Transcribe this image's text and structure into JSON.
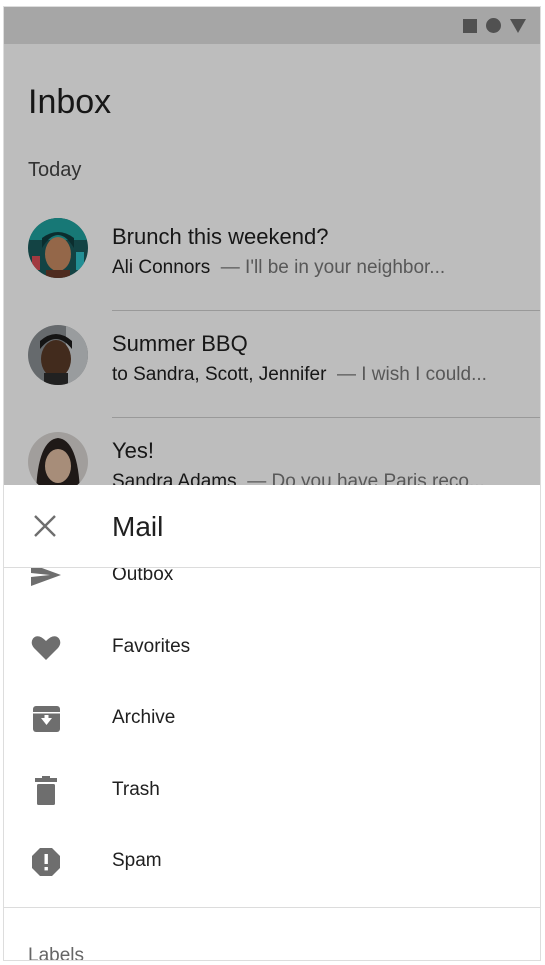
{
  "inbox": {
    "title": "Inbox",
    "section": "Today",
    "messages": [
      {
        "subject": "Brunch this weekend?",
        "from": "Ali Connors",
        "snippet": "— I'll be in your neighbor..."
      },
      {
        "subject": "Summer BBQ",
        "from": "to Sandra, Scott, Jennifer",
        "snippet": "— I wish I could..."
      },
      {
        "subject": "Yes!",
        "from": "Sandra Adams",
        "snippet": "— Do you have Paris reco..."
      }
    ]
  },
  "sheet": {
    "title": "Mail",
    "items": [
      {
        "label": "Outbox",
        "icon": "send-icon"
      },
      {
        "label": "Favorites",
        "icon": "heart-icon"
      },
      {
        "label": "Archive",
        "icon": "archive-icon"
      },
      {
        "label": "Trash",
        "icon": "trash-icon"
      },
      {
        "label": "Spam",
        "icon": "report-icon"
      }
    ],
    "labels_heading": "Labels"
  },
  "colors": {
    "scrim": "rgba(0,0,0,0.26)",
    "icon_gray": "#6e6e6e",
    "text_primary": "#202020"
  }
}
